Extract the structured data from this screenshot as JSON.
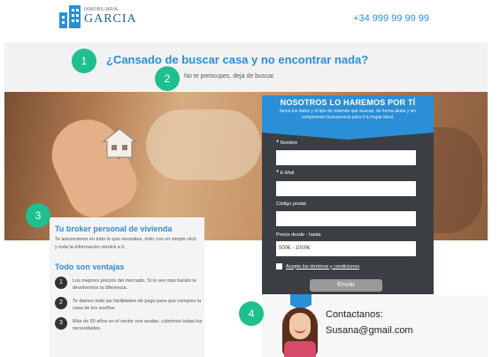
{
  "header": {
    "logo_sub": "INMOBILIARIA",
    "logo_name": "GARCIA",
    "phone": "+34 999 99 99 99"
  },
  "hero": {
    "headline": "¿Cansado de buscar casa y no encontrar nada?",
    "subline": "No te preocupes, deja de buscar."
  },
  "markers": [
    "1",
    "2",
    "3",
    "4"
  ],
  "form": {
    "title": "NOSOTROS LO HAREMOS POR TÍ",
    "description": "Ïanos tus datos y el tipo de vivienda que buscas, de forma atuita y sin compromiso buscaremos para tí tu hogar ideal.",
    "fields": [
      {
        "label": "Nombre",
        "required": "*",
        "value": ""
      },
      {
        "label": "E-Mail",
        "required": "*",
        "value": ""
      },
      {
        "label": "Código postal",
        "value": ""
      },
      {
        "label": "Precio desde - hasta",
        "value": "500€ - 1000€"
      }
    ],
    "terms_label": "Acepto los términos y condiciones",
    "submit_label": "Enviar"
  },
  "broker": {
    "title": "Tu broker personal de vivienda",
    "text": "Te asesoramos en todo lo que necesites, todo con un simple click y toda la información vendrá a tí.",
    "advantages_title": "Todo son ventajas",
    "advantages": [
      {
        "num": "1",
        "text": "Los mejores precios del mercado. Si lo ves más barato te devolvemos la diferencia."
      },
      {
        "num": "2",
        "text": "Te damos toda las facilidades de pago para que compres la casa de tus sueños."
      },
      {
        "num": "3",
        "text": "Más de 50 años en el sector nos avalan, cubrimos todas tus necesidades."
      }
    ]
  },
  "contact": {
    "label": "Contactanos:",
    "email": "Susana@gmail.com"
  },
  "colors": {
    "accent": "#2a8fd6",
    "marker": "#1fbf8f",
    "form_bg": "#3b3f44"
  }
}
